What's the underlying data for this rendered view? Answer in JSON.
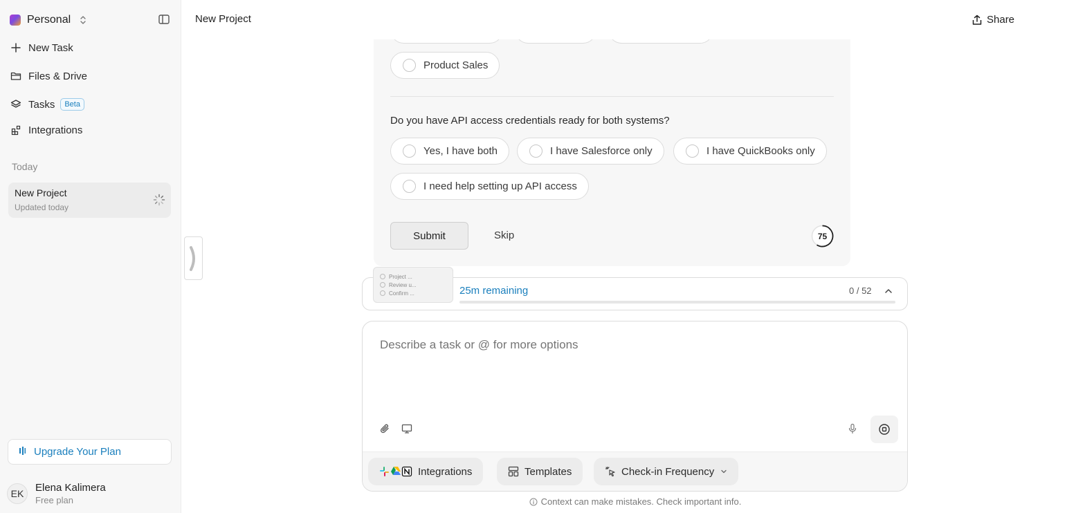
{
  "sidebar": {
    "workspace": "Personal",
    "nav": {
      "new_task": "New Task",
      "files": "Files & Drive",
      "tasks": "Tasks",
      "tasks_badge": "Beta",
      "integrations": "Integrations"
    },
    "section_today": "Today",
    "project": {
      "title": "New Project",
      "subtitle": "Updated today"
    },
    "upgrade": "Upgrade Your Plan",
    "user": {
      "initials": "EK",
      "name": "Elena Kalimera",
      "plan": "Free plan"
    }
  },
  "header": {
    "title": "New Project",
    "share": "Share"
  },
  "question_card": {
    "option_product_sales": "Product Sales",
    "question": "Do you have API access credentials ready for both systems?",
    "options": [
      "Yes, I have both",
      "I have Salesforce only",
      "I have QuickBooks only",
      "I need help setting up API access"
    ],
    "submit": "Submit",
    "skip": "Skip",
    "timer": "75"
  },
  "progress": {
    "thumbnail": [
      "Project ...",
      "Review u...",
      "Confirm ..."
    ],
    "remaining": "25m remaining",
    "count": "0 / 52",
    "fraction": 0
  },
  "composer": {
    "placeholder": "Describe a task or @ for more options",
    "chips": {
      "integrations": "Integrations",
      "templates": "Templates",
      "checkin": "Check-in Frequency"
    }
  },
  "disclaimer": "Context can make mistakes. Check important info.",
  "colors": {
    "accent": "#1a7fbd"
  }
}
